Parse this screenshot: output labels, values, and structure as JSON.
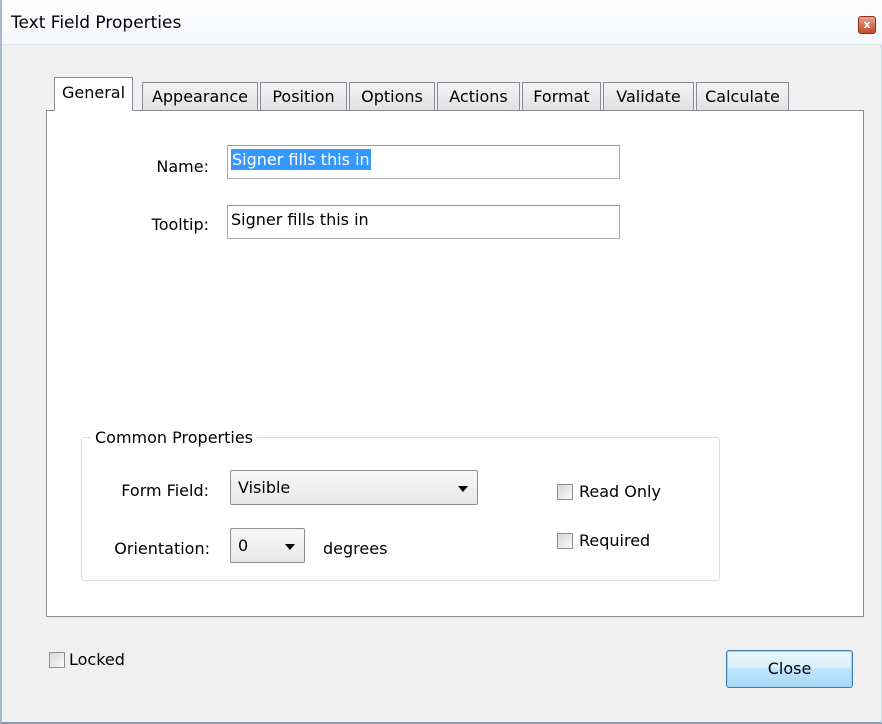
{
  "window": {
    "title": "Text Field Properties",
    "close_glyph": "x"
  },
  "tabs": [
    {
      "label": "General",
      "active": true
    },
    {
      "label": "Appearance",
      "active": false
    },
    {
      "label": "Position",
      "active": false
    },
    {
      "label": "Options",
      "active": false
    },
    {
      "label": "Actions",
      "active": false
    },
    {
      "label": "Format",
      "active": false
    },
    {
      "label": "Validate",
      "active": false
    },
    {
      "label": "Calculate",
      "active": false
    }
  ],
  "general": {
    "name_label": "Name:",
    "name_value": "Signer fills this in",
    "tooltip_label": "Tooltip:",
    "tooltip_value": "Signer fills this in"
  },
  "common_properties": {
    "title": "Common Properties",
    "form_field_label": "Form Field:",
    "form_field_value": "Visible",
    "orientation_label": "Orientation:",
    "orientation_value": "0",
    "orientation_unit": "degrees",
    "read_only_label": "Read Only",
    "read_only_checked": false,
    "required_label": "Required",
    "required_checked": false
  },
  "footer": {
    "locked_label": "Locked",
    "locked_checked": false,
    "close_label": "Close"
  },
  "colors": {
    "selection": "#3399ff",
    "close_button_border": "#3c7fb1",
    "window_close": "#c6482d"
  }
}
